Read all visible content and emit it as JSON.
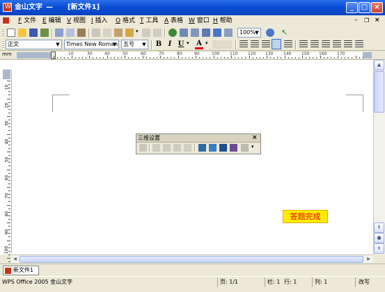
{
  "window": {
    "title_app": "金山文字",
    "title_dash": "—",
    "title_doc": "[新文件1]"
  },
  "menu": [
    {
      "key": "F",
      "label": "文件"
    },
    {
      "key": "E",
      "label": "编辑"
    },
    {
      "key": "V",
      "label": "视图"
    },
    {
      "key": "I",
      "label": "插入"
    },
    {
      "key": "O",
      "label": "格式"
    },
    {
      "key": "T",
      "label": "工具"
    },
    {
      "key": "A",
      "label": "表格"
    },
    {
      "key": "W",
      "label": "窗口"
    },
    {
      "key": "H",
      "label": "帮助"
    }
  ],
  "toolbar": {
    "zoom": "100%"
  },
  "format_bar": {
    "style": "正文",
    "font": "Times New Roman",
    "size": "五号",
    "bold": "B",
    "italic": "I",
    "underline": "U",
    "font_color": "A"
  },
  "ruler": {
    "numbers": [
      "10",
      "30",
      "40",
      "50",
      "60",
      "70",
      "80",
      "90",
      "100",
      "110",
      "120",
      "130",
      "140",
      "150",
      "160",
      "170"
    ],
    "unit": "mm",
    "vertical_numbers": [
      "10",
      "20",
      "30",
      "40",
      "50",
      "60",
      "70",
      "80",
      "90",
      "100"
    ]
  },
  "palette": {
    "title": "三维设置",
    "close": "×"
  },
  "badge": {
    "text": "答题完成"
  },
  "doc_tab": {
    "label": "新文件1"
  },
  "status": {
    "app": "WPS Office 2005 金山文字",
    "page": "页: 1/1",
    "col": "栏: 1",
    "row": "行: 1",
    "column": "列: 1",
    "mode": "改写"
  }
}
